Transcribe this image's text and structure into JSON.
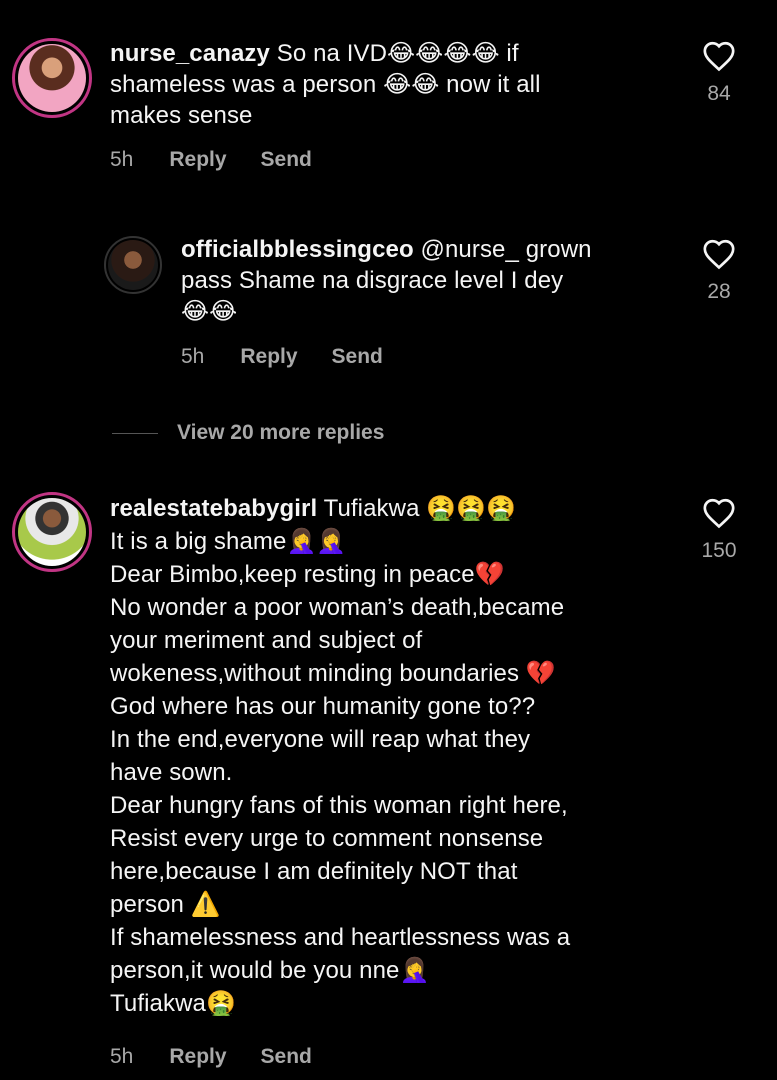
{
  "comments": [
    {
      "username": "nurse_canazy",
      "lines": [
        "So na IVD😂😂😂😂 if",
        "shameless was a person 😂😂 now it all",
        "makes sense"
      ],
      "time": "5h",
      "reply_label": "Reply",
      "send_label": "Send",
      "likes": "84"
    },
    {
      "username": "officialbblessingceo",
      "lines": [
        "@nurse_ grown",
        "pass Shame na disgrace level I dey",
        "😂😂"
      ],
      "time": "5h",
      "reply_label": "Reply",
      "send_label": "Send",
      "likes": "28"
    },
    {
      "username": "realestatebabygirl",
      "lines": [
        "Tufiakwa 🤮🤮🤮",
        "It is a big shame🤦‍♀️🤦‍♀️",
        "Dear Bimbo,keep resting in peace💔",
        "No wonder a poor woman’s death,became",
        "your meriment and subject of",
        "wokeness,without minding boundaries 💔",
        "God where has our humanity gone to??",
        "In the end,everyone will reap what they",
        "have sown.",
        "Dear hungry fans of this woman right here,",
        "Resist every urge to comment nonsense",
        "here,because I am definitely NOT that",
        "person ⚠️",
        "If shamelessness and heartlessness was a",
        "person,it would be you nne🤦‍♀️",
        "Tufiakwa🤮"
      ],
      "time": "5h",
      "reply_label": "Reply",
      "send_label": "Send",
      "likes": "150"
    }
  ],
  "view_replies": "View 20 more replies",
  "icons": {
    "like": "heart-outline-icon"
  },
  "colors": {
    "text": "#f5f5f5",
    "muted": "#a8a8a8",
    "ring": "#c13584"
  }
}
